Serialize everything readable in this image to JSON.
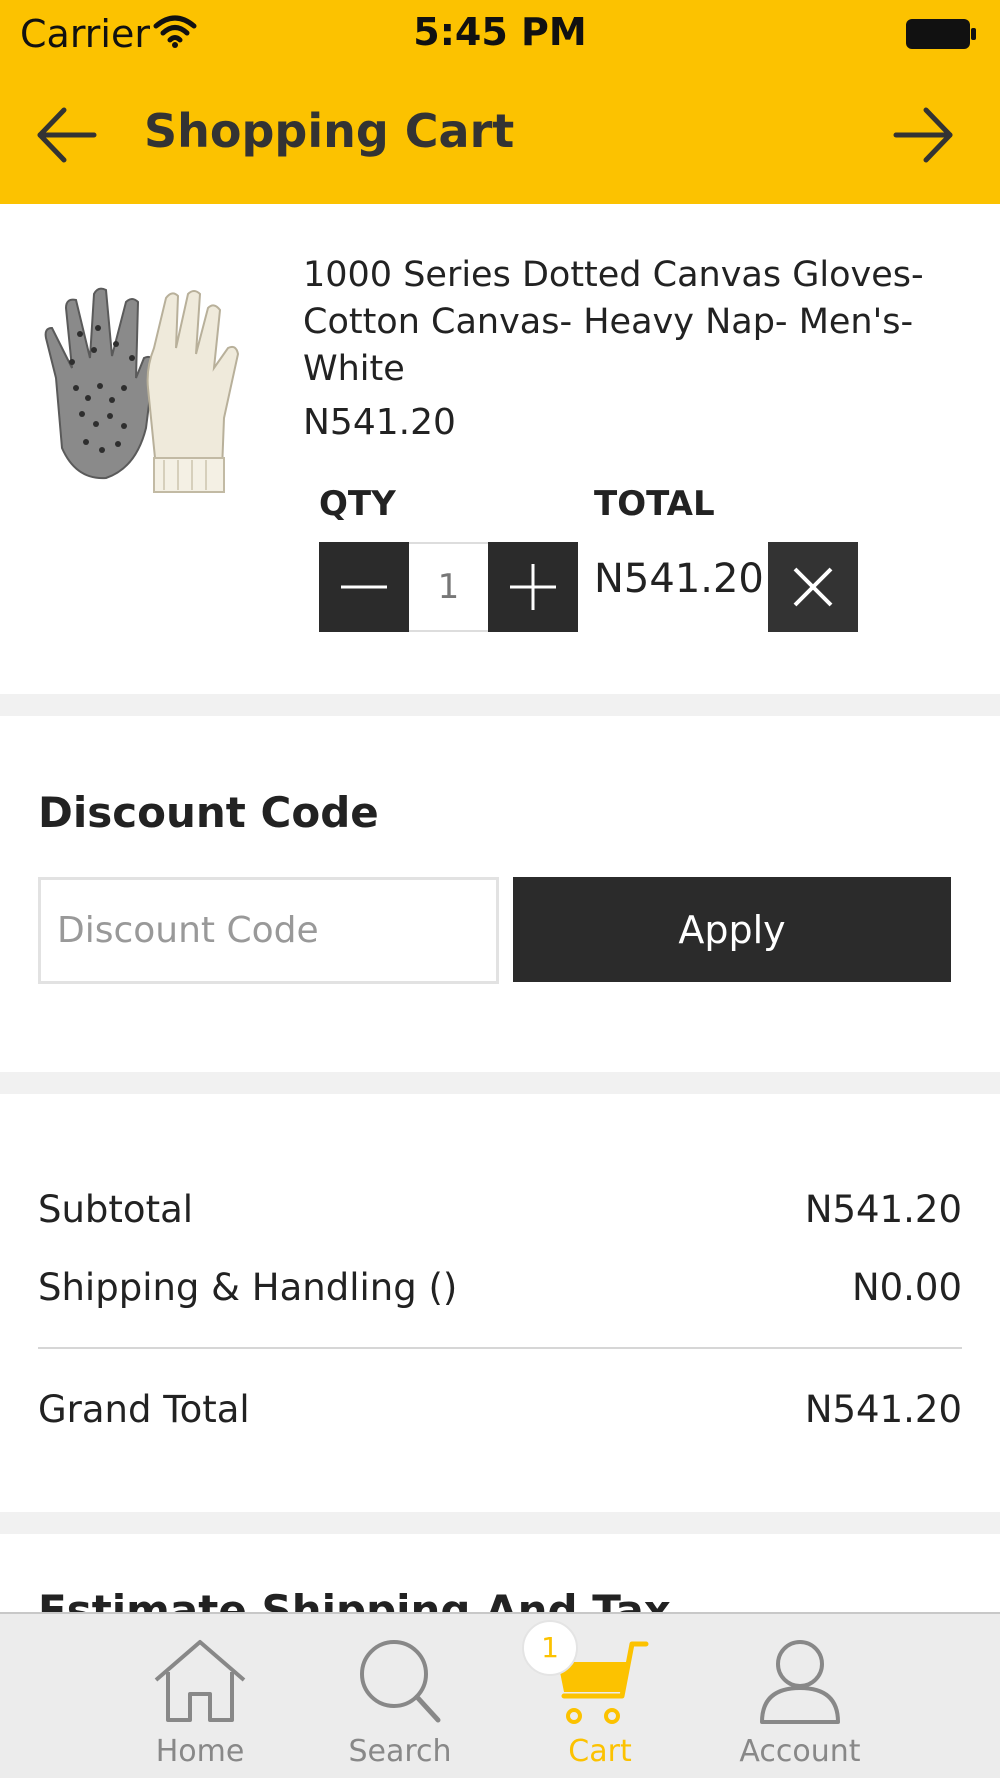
{
  "status_bar": {
    "carrier": "Carrier",
    "time": "5:45 PM"
  },
  "nav_bar": {
    "title": "Shopping Cart",
    "back_icon": "arrow-left-icon",
    "forward_icon": "arrow-right-icon"
  },
  "cart_item": {
    "name": "1000 Series Dotted Canvas Gloves-Cotton Canvas- Heavy Nap- Men's-White",
    "price": "N541.20",
    "qty_label": "QTY",
    "total_label": "TOTAL",
    "quantity": "1",
    "line_total": "N541.20"
  },
  "discount": {
    "title": "Discount Code",
    "placeholder": "Discount Code",
    "value": "",
    "apply_label": "Apply"
  },
  "totals": {
    "subtotal_label": "Subtotal",
    "subtotal_value": "N541.20",
    "shipping_label": "Shipping & Handling ()",
    "shipping_value": "N0.00",
    "grand_total_label": "Grand Total",
    "grand_total_value": "N541.20"
  },
  "next_section": {
    "title": "Estimate Shipping And Tax"
  },
  "tab_bar": {
    "tabs": [
      {
        "label": "Home",
        "icon": "home-icon"
      },
      {
        "label": "Search",
        "icon": "search-icon"
      },
      {
        "label": "Cart",
        "icon": "cart-icon",
        "badge": "1"
      },
      {
        "label": "Account",
        "icon": "account-icon"
      }
    ],
    "active_index": 2
  },
  "colors": {
    "accent": "#fcc200",
    "dark_button": "#2b2b2b",
    "separator": "#f1f1f1",
    "tab_inactive": "#888888",
    "tab_bar_bg": "#ececec"
  }
}
